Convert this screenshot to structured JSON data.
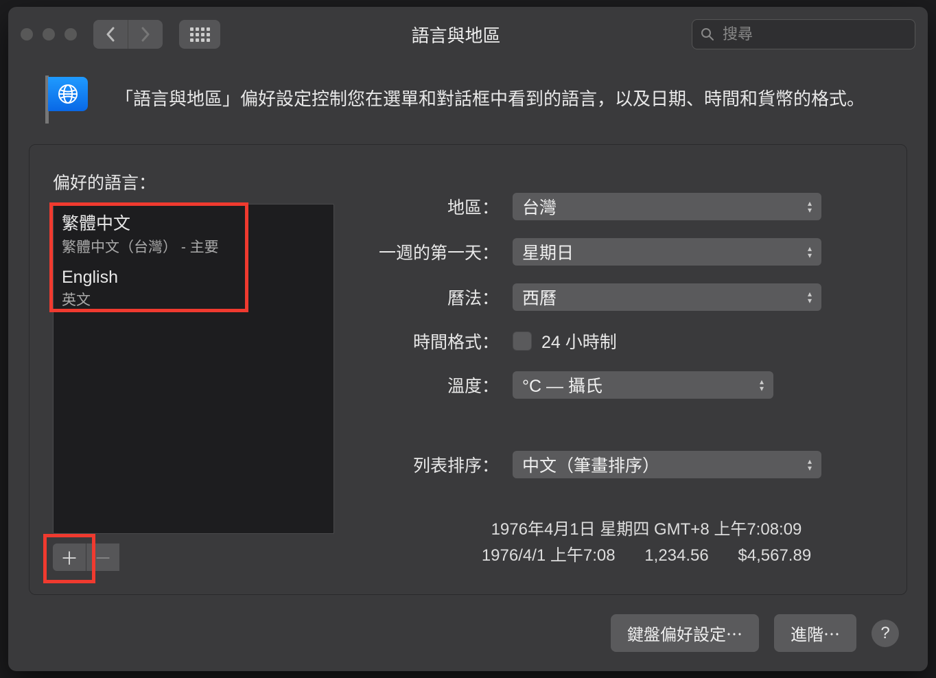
{
  "window": {
    "title": "語言與地區",
    "search_placeholder": "搜尋"
  },
  "intro": "「語言與地區」偏好設定控制您在選單和對話框中看到的語言，以及日期、時間和貨幣的格式。",
  "preferred_languages_label": "偏好的語言：",
  "languages": [
    {
      "title": "繁體中文",
      "subtitle": "繁體中文（台灣）  - 主要"
    },
    {
      "title": "English",
      "subtitle": "英文"
    }
  ],
  "settings": {
    "region": {
      "label": "地區：",
      "value": "台灣"
    },
    "first_day": {
      "label": "一週的第一天：",
      "value": "星期日"
    },
    "calendar": {
      "label": "曆法：",
      "value": "西曆"
    },
    "time_format": {
      "label": "時間格式：",
      "value": "24 小時制"
    },
    "temperature": {
      "label": "溫度：",
      "value": "°C — 攝氏"
    },
    "list_sort": {
      "label": "列表排序：",
      "value": "中文（筆畫排序）"
    }
  },
  "sample": {
    "line1": "1976年4月1日 星期四 GMT+8 上午7:08:09",
    "line2_a": "1976/4/1 上午7:08",
    "line2_b": "1,234.56",
    "line2_c": "$4,567.89"
  },
  "footer": {
    "keyboard": "鍵盤偏好設定⋯",
    "advanced": "進階⋯",
    "help": "?"
  }
}
